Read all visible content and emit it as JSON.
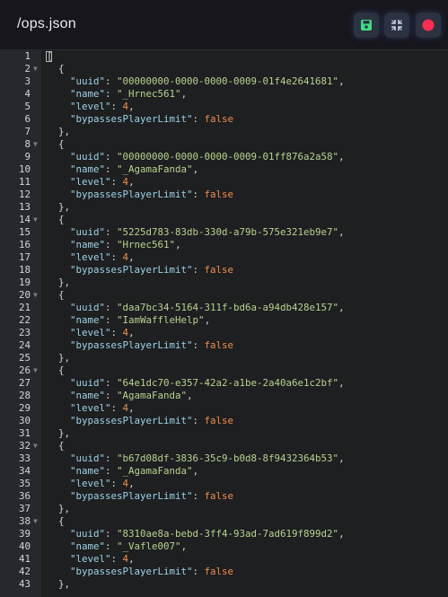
{
  "header": {
    "title": "/ops.json",
    "buttons": [
      {
        "name": "save-button",
        "icon": "save-icon",
        "color": "#3ddc84"
      },
      {
        "name": "collapse-button",
        "icon": "collapse-icon",
        "color": "#c9d4e8"
      },
      {
        "name": "close-button",
        "icon": "record-icon",
        "color": "#ff2d55"
      }
    ]
  },
  "editor": {
    "entries": [
      {
        "uuid": "00000000-0000-0000-0009-01f4e2641681",
        "name": "_Hrnec561",
        "level": "4",
        "bypassesPlayerLimit": "false"
      },
      {
        "uuid": "00000000-0000-0000-0009-01ff876a2a58",
        "name": "_AgamaFanda",
        "level": "4",
        "bypassesPlayerLimit": "false"
      },
      {
        "uuid": "5225d783-83db-330d-a79b-575e321eb9e7",
        "name": "Hrnec561",
        "level": "4",
        "bypassesPlayerLimit": "false"
      },
      {
        "uuid": "daa7bc34-5164-311f-bd6a-a94db428e157",
        "name": "IamWaffleHelp",
        "level": "4",
        "bypassesPlayerLimit": "false"
      },
      {
        "uuid": "64e1dc70-e357-42a2-a1be-2a40a6e1c2bf",
        "name": "AgamaFanda",
        "level": "4",
        "bypassesPlayerLimit": "false"
      },
      {
        "uuid": "b67d08df-3836-35c9-b0d8-8f9432364b53",
        "name": "_AgamaFanda",
        "level": "4",
        "bypassesPlayerLimit": "false"
      },
      {
        "uuid": "8310ae8a-bebd-3ff4-93ad-7ad619f899d2",
        "name": "_Vafle007",
        "level": "4",
        "bypassesPlayerLimit": "false"
      }
    ]
  }
}
